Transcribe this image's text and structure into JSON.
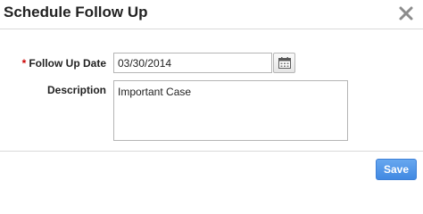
{
  "dialog": {
    "title": "Schedule Follow Up"
  },
  "form": {
    "required_marker": "*",
    "follow_up_date": {
      "label": "Follow Up Date",
      "value": "03/30/2014"
    },
    "description": {
      "label": "Description",
      "value": "Important Case"
    }
  },
  "footer": {
    "save_label": "Save"
  },
  "icons": {
    "close": "close-icon",
    "calendar": "calendar-icon"
  },
  "colors": {
    "accent": "#4a90e2",
    "required": "#cc0000",
    "title_text": "#222222"
  }
}
